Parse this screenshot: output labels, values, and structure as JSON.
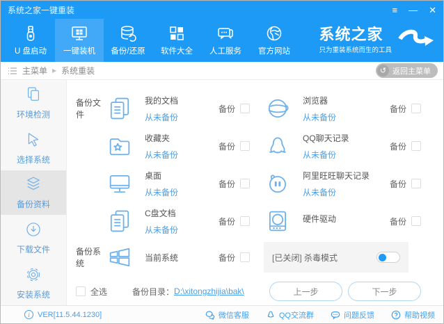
{
  "window": {
    "title": "系统之家一键重装"
  },
  "icons": {
    "menu_glyph": "≡",
    "minimize_glyph": "—",
    "close_glyph": "✕",
    "crumb_arrow": "▶",
    "back_arrow": "↺",
    "info_glyph": "i"
  },
  "nav": {
    "items": [
      {
        "label": "U 盘启动",
        "active": false
      },
      {
        "label": "一键装机",
        "active": true
      },
      {
        "label": "备份/还原",
        "active": false
      },
      {
        "label": "软件大全",
        "active": false
      },
      {
        "label": "人工服务",
        "active": false
      },
      {
        "label": "官方网站",
        "active": false
      }
    ],
    "brand": {
      "name": "系统之家",
      "tagline": "只为重装系统而生的工具"
    }
  },
  "breadcrumb": {
    "root": "主菜单",
    "current": "系统重装",
    "back_button": "返回主菜单"
  },
  "sidebar": {
    "items": [
      {
        "label": "环境检测",
        "active": false
      },
      {
        "label": "选择系统",
        "active": false
      },
      {
        "label": "备份资料",
        "active": true
      },
      {
        "label": "下载文件",
        "active": false
      },
      {
        "label": "安装系统",
        "active": false
      }
    ]
  },
  "main": {
    "backup_files_label": "备份文件",
    "backup_system_label": "备份系统",
    "backup_label": "备份",
    "items": [
      {
        "title": "我的文档",
        "status": "从未备份"
      },
      {
        "title": "浏览器",
        "status": "从未备份"
      },
      {
        "title": "收藏夹",
        "status": "从未备份"
      },
      {
        "title": "QQ聊天记录",
        "status": "从未备份"
      },
      {
        "title": "桌面",
        "status": "从未备份"
      },
      {
        "title": "阿里旺旺聊天记录",
        "status": "从未备份"
      },
      {
        "title": "C盘文档",
        "status": "从未备份"
      },
      {
        "title": "硬件驱动",
        "status": ""
      }
    ],
    "system_item": {
      "title": "当前系统"
    },
    "antivirus": {
      "label": "[已关闭] 杀毒模式",
      "state": "off"
    },
    "select_all": "全选",
    "backup_dir_label": "备份目录：",
    "backup_dir": "D:\\xitongzhijia\\bak\\",
    "prev_button": "上一步",
    "next_button": "下一步"
  },
  "footer": {
    "version": "VER[11.5.44.1230]",
    "links": [
      "微信客服",
      "QQ交流群",
      "问题反馈",
      "帮助视频"
    ]
  }
}
